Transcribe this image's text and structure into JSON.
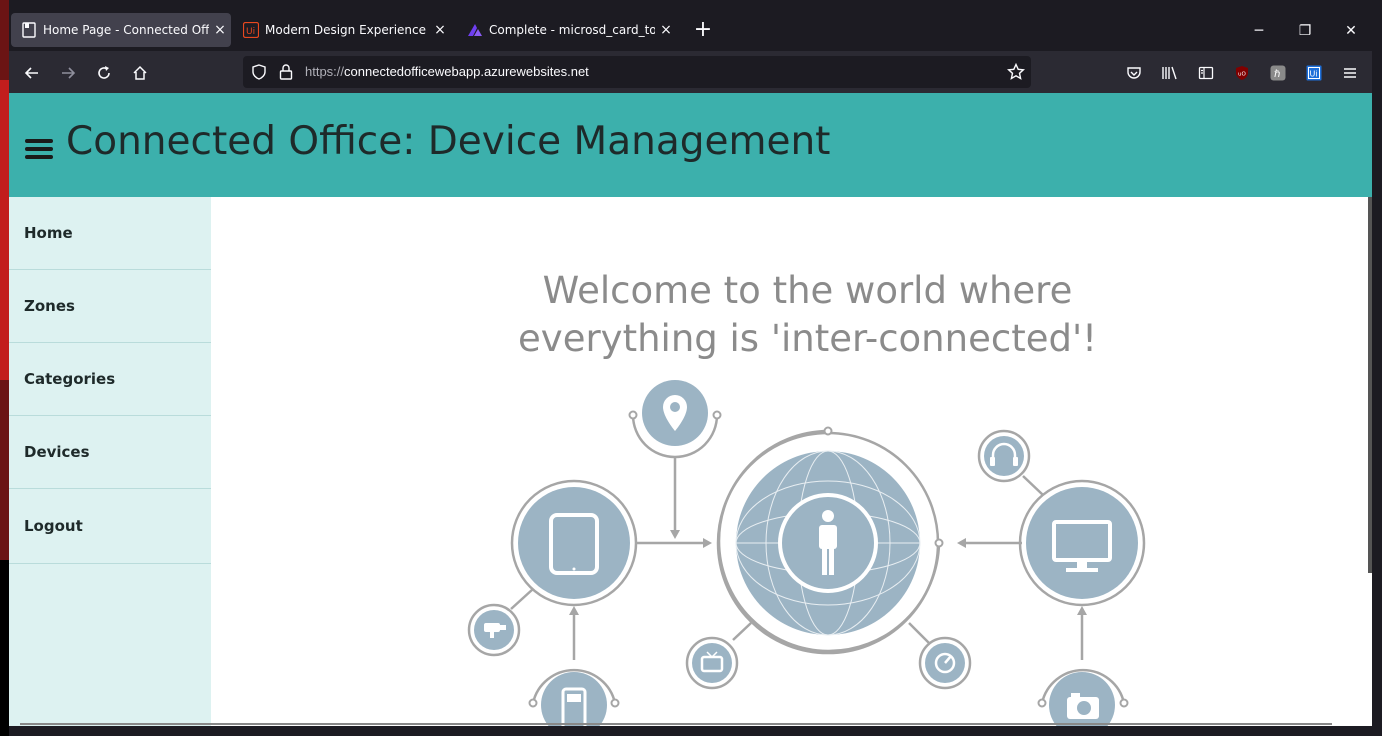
{
  "browser": {
    "tabs": [
      {
        "title": "Home Page - Connected Office",
        "active": true
      },
      {
        "title": "Modern Design Experience",
        "active": false
      },
      {
        "title": "Complete - microsd_card_top.g",
        "active": false
      }
    ],
    "new_tab_symbol": "+",
    "close_symbol": "×",
    "window_controls": {
      "minimize": "─",
      "restore": "❐",
      "close": "✕"
    },
    "url": {
      "prefix": "https://",
      "host": "connectedofficewebapp.azurewebsites.net"
    }
  },
  "header": {
    "title": "Connected Office: Device Management",
    "color": "#3cb0ac"
  },
  "sidebar": {
    "items": [
      {
        "label": "Home"
      },
      {
        "label": "Zones"
      },
      {
        "label": "Categories"
      },
      {
        "label": "Devices"
      },
      {
        "label": "Logout"
      }
    ],
    "color": "#ddf2f1"
  },
  "main": {
    "welcome_line1": "Welcome to the world where",
    "welcome_line2": "everything is 'inter-connected'!",
    "illustration_color": "#9cb4c4"
  }
}
